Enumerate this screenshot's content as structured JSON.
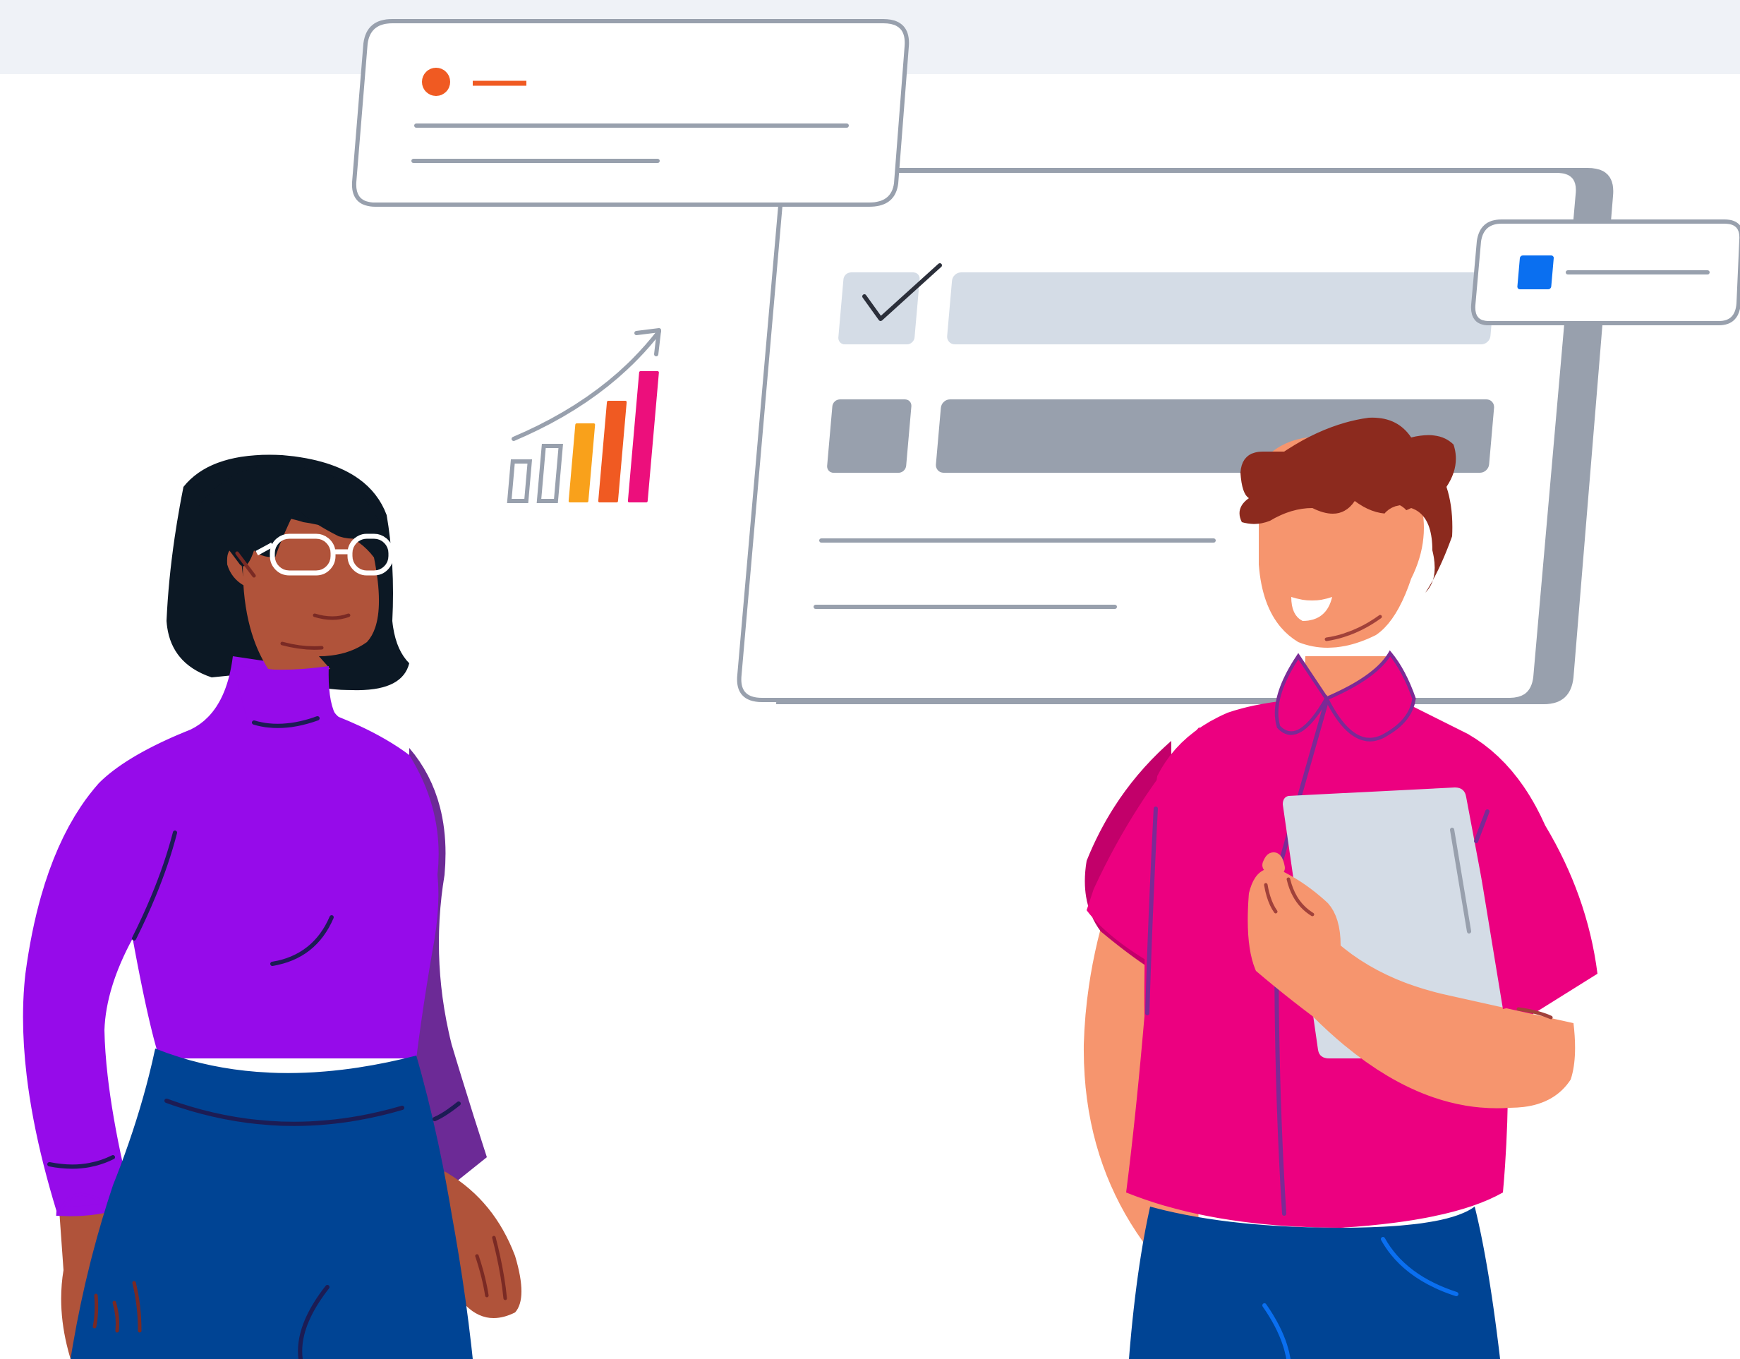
{
  "colors": {
    "background": "#ffffff",
    "top_band": "#eff2f7",
    "card_border": "#98a0ad",
    "placeholder_light": "#d4dce6",
    "placeholder_dark": "#98a0ad",
    "accent_orange": "#f05a22",
    "accent_yellow": "#f9a11b",
    "accent_magenta": "#ec0f7c",
    "accent_blue": "#0a6ff0",
    "ink_dark": "#2b2f3a"
  },
  "illustration": {
    "notification_card": {
      "icon": "orange-dot-icon"
    },
    "main_window": {
      "rows": [
        "checked-row",
        "grey-row",
        "text-line",
        "text-line"
      ],
      "check_icon": "checkmark-icon"
    },
    "small_card": {
      "icon": "blue-square-icon"
    },
    "growth_chart": {
      "icon": "rising-trend-arrow-icon",
      "bars": 5
    },
    "people": [
      "woman-with-glasses",
      "man-with-tablet"
    ]
  }
}
